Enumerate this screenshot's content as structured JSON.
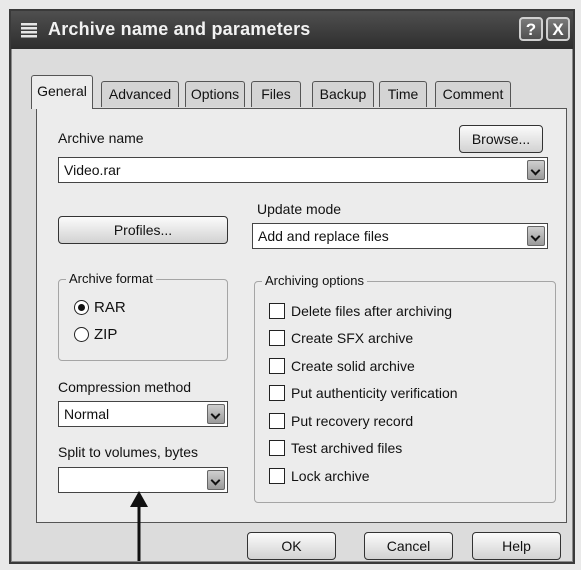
{
  "window": {
    "title": "Archive name and parameters",
    "help_label": "?",
    "close_label": "X"
  },
  "tabs": [
    {
      "label": "General",
      "active": true
    },
    {
      "label": "Advanced"
    },
    {
      "label": "Options"
    },
    {
      "label": "Files"
    },
    {
      "label": "Backup"
    },
    {
      "label": "Time"
    },
    {
      "label": "Comment"
    }
  ],
  "general": {
    "archive_name_label": "Archive name",
    "archive_name_value": "Video.rar",
    "browse_label": "Browse...",
    "profiles_label": "Profiles...",
    "update_mode_label": "Update mode",
    "update_mode_value": "Add and replace files",
    "archive_format": {
      "legend": "Archive format",
      "options": [
        {
          "label": "RAR",
          "selected": true
        },
        {
          "label": "ZIP",
          "selected": false
        }
      ]
    },
    "compression_label": "Compression method",
    "compression_value": "Normal",
    "split_label": "Split to volumes, bytes",
    "split_value": "",
    "archiving_options": {
      "legend": "Archiving options",
      "items": [
        {
          "label": "Delete files after archiving",
          "checked": false
        },
        {
          "label": "Create SFX archive",
          "checked": false
        },
        {
          "label": "Create solid archive",
          "checked": false
        },
        {
          "label": "Put authenticity verification",
          "checked": false
        },
        {
          "label": "Put recovery record",
          "checked": false
        },
        {
          "label": "Test archived files",
          "checked": false
        },
        {
          "label": "Lock archive",
          "checked": false
        }
      ]
    }
  },
  "footer": {
    "ok_label": "OK",
    "cancel_label": "Cancel",
    "help_label": "Help"
  }
}
